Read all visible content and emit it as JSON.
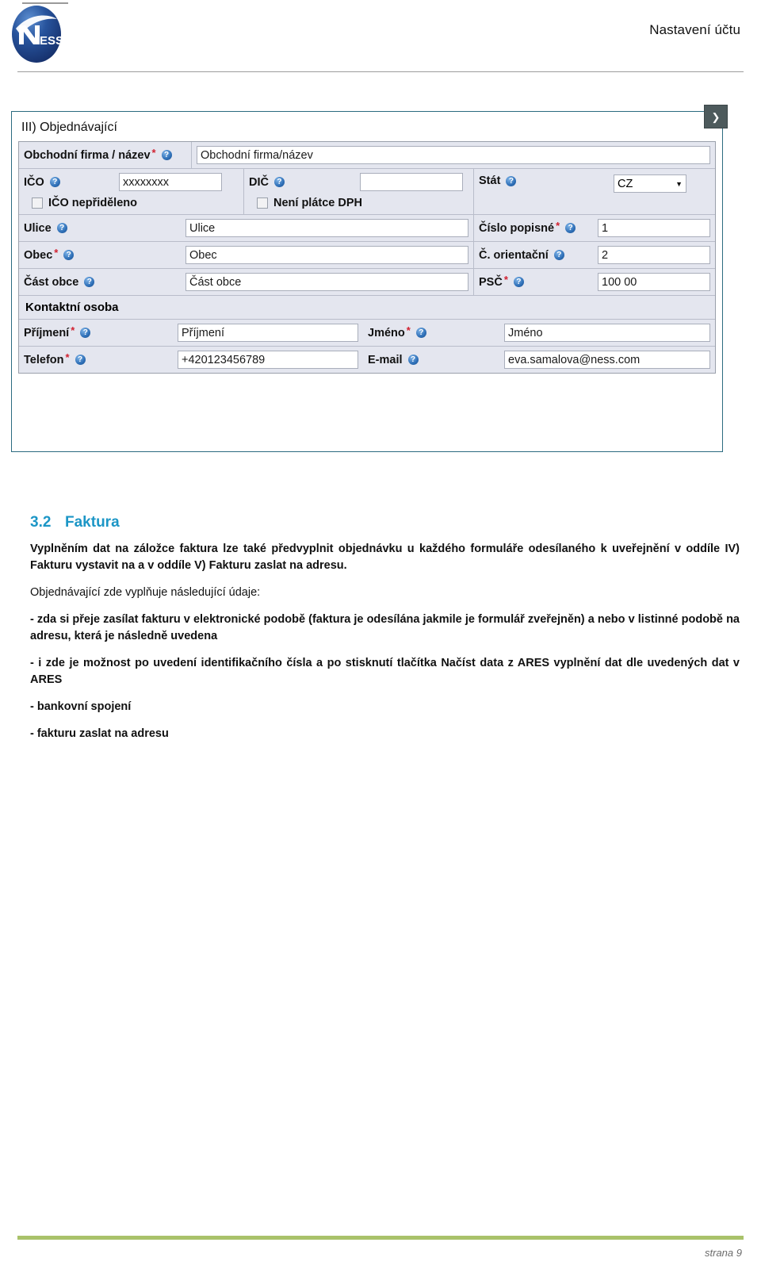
{
  "header": {
    "title": "Nastavení účtu",
    "logo_text": "NESS"
  },
  "screenshot": {
    "scroll_button_icon": "chevron-right-icon",
    "panel_title": "III) Objednávající",
    "rows": {
      "company": {
        "label": "Obchodní firma / název",
        "required": "*",
        "help": "?",
        "value": "Obchodní firma/název"
      },
      "ico": {
        "label": "IČO",
        "help": "?",
        "value": "xxxxxxxx",
        "checkbox_label": "IČO nepřiděleno"
      },
      "dic": {
        "label": "DIČ",
        "help": "?",
        "value": "",
        "checkbox_label": "Není plátce DPH"
      },
      "stat": {
        "label": "Stát",
        "help": "?",
        "value": "CZ",
        "caret": "▼"
      },
      "ulice": {
        "label": "Ulice",
        "help": "?",
        "value": "Ulice"
      },
      "obec": {
        "label": "Obec",
        "required": "*",
        "help": "?",
        "value": "Obec"
      },
      "cast_obce": {
        "label": "Část obce",
        "help": "?",
        "value": "Část obce"
      },
      "cislo_popisne": {
        "label": "Číslo popisné",
        "required": "*",
        "help": "?",
        "value": "1"
      },
      "c_orientacni": {
        "label": "Č. orientační",
        "help": "?",
        "value": "2"
      },
      "psc": {
        "label": "PSČ",
        "required": "*",
        "help": "?",
        "value": "100 00"
      },
      "contact_header": "Kontaktní osoba",
      "prijmeni": {
        "label": "Příjmení",
        "required": "*",
        "help": "?",
        "value": "Příjmení"
      },
      "jmeno": {
        "label": "Jméno",
        "required": "*",
        "help": "?",
        "value": "Jméno"
      },
      "telefon": {
        "label": "Telefon",
        "required": "*",
        "help": "?",
        "value": "+420123456789"
      },
      "email": {
        "label": "E-mail",
        "help": "?",
        "value": "eva.samalova@ness.com"
      }
    }
  },
  "section": {
    "number": "3.2",
    "title": "Faktura",
    "paragraph1": "Vyplněním dat na záložce faktura lze také předvyplnit objednávku u každého formuláře odesílaného k uveřejnění v oddíle IV) Fakturu vystavit na a v oddíle V) Fakturu zaslat na adresu.",
    "paragraph2": "Objednávající zde vyplňuje následující údaje:",
    "bullets": [
      "- zda si přeje zasílat fakturu v elektronické podobě (faktura je odesílána jakmile je formulář zveřejněn) a nebo v listinné podobě na adresu, která je následně uvedena",
      "- i zde je možnost po uvedení identifikačního čísla a po stisknutí tlačítka Načíst data z ARES vyplnění dat dle uvedených dat v ARES",
      "- bankovní spojení",
      "- fakturu zaslat na adresu"
    ]
  },
  "footer": {
    "page_label": "strana 9"
  },
  "colors": {
    "accent_heading": "#1c96c6",
    "footer_rule": "#a9c26a",
    "panel_border": "#2b6b80",
    "form_bg": "#e4e6ef",
    "required_star": "#d1202f"
  }
}
